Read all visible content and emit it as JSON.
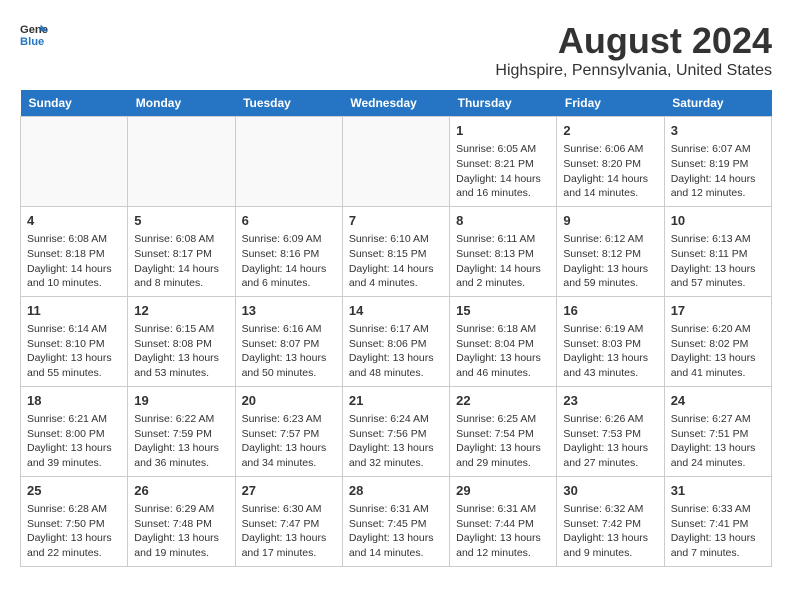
{
  "header": {
    "logo_line1": "General",
    "logo_line2": "Blue",
    "title": "August 2024",
    "subtitle": "Highspire, Pennsylvania, United States"
  },
  "days_of_week": [
    "Sunday",
    "Monday",
    "Tuesday",
    "Wednesday",
    "Thursday",
    "Friday",
    "Saturday"
  ],
  "weeks": [
    [
      {
        "day": "",
        "info": ""
      },
      {
        "day": "",
        "info": ""
      },
      {
        "day": "",
        "info": ""
      },
      {
        "day": "",
        "info": ""
      },
      {
        "day": "1",
        "info": "Sunrise: 6:05 AM\nSunset: 8:21 PM\nDaylight: 14 hours\nand 16 minutes."
      },
      {
        "day": "2",
        "info": "Sunrise: 6:06 AM\nSunset: 8:20 PM\nDaylight: 14 hours\nand 14 minutes."
      },
      {
        "day": "3",
        "info": "Sunrise: 6:07 AM\nSunset: 8:19 PM\nDaylight: 14 hours\nand 12 minutes."
      }
    ],
    [
      {
        "day": "4",
        "info": "Sunrise: 6:08 AM\nSunset: 8:18 PM\nDaylight: 14 hours\nand 10 minutes."
      },
      {
        "day": "5",
        "info": "Sunrise: 6:08 AM\nSunset: 8:17 PM\nDaylight: 14 hours\nand 8 minutes."
      },
      {
        "day": "6",
        "info": "Sunrise: 6:09 AM\nSunset: 8:16 PM\nDaylight: 14 hours\nand 6 minutes."
      },
      {
        "day": "7",
        "info": "Sunrise: 6:10 AM\nSunset: 8:15 PM\nDaylight: 14 hours\nand 4 minutes."
      },
      {
        "day": "8",
        "info": "Sunrise: 6:11 AM\nSunset: 8:13 PM\nDaylight: 14 hours\nand 2 minutes."
      },
      {
        "day": "9",
        "info": "Sunrise: 6:12 AM\nSunset: 8:12 PM\nDaylight: 13 hours\nand 59 minutes."
      },
      {
        "day": "10",
        "info": "Sunrise: 6:13 AM\nSunset: 8:11 PM\nDaylight: 13 hours\nand 57 minutes."
      }
    ],
    [
      {
        "day": "11",
        "info": "Sunrise: 6:14 AM\nSunset: 8:10 PM\nDaylight: 13 hours\nand 55 minutes."
      },
      {
        "day": "12",
        "info": "Sunrise: 6:15 AM\nSunset: 8:08 PM\nDaylight: 13 hours\nand 53 minutes."
      },
      {
        "day": "13",
        "info": "Sunrise: 6:16 AM\nSunset: 8:07 PM\nDaylight: 13 hours\nand 50 minutes."
      },
      {
        "day": "14",
        "info": "Sunrise: 6:17 AM\nSunset: 8:06 PM\nDaylight: 13 hours\nand 48 minutes."
      },
      {
        "day": "15",
        "info": "Sunrise: 6:18 AM\nSunset: 8:04 PM\nDaylight: 13 hours\nand 46 minutes."
      },
      {
        "day": "16",
        "info": "Sunrise: 6:19 AM\nSunset: 8:03 PM\nDaylight: 13 hours\nand 43 minutes."
      },
      {
        "day": "17",
        "info": "Sunrise: 6:20 AM\nSunset: 8:02 PM\nDaylight: 13 hours\nand 41 minutes."
      }
    ],
    [
      {
        "day": "18",
        "info": "Sunrise: 6:21 AM\nSunset: 8:00 PM\nDaylight: 13 hours\nand 39 minutes."
      },
      {
        "day": "19",
        "info": "Sunrise: 6:22 AM\nSunset: 7:59 PM\nDaylight: 13 hours\nand 36 minutes."
      },
      {
        "day": "20",
        "info": "Sunrise: 6:23 AM\nSunset: 7:57 PM\nDaylight: 13 hours\nand 34 minutes."
      },
      {
        "day": "21",
        "info": "Sunrise: 6:24 AM\nSunset: 7:56 PM\nDaylight: 13 hours\nand 32 minutes."
      },
      {
        "day": "22",
        "info": "Sunrise: 6:25 AM\nSunset: 7:54 PM\nDaylight: 13 hours\nand 29 minutes."
      },
      {
        "day": "23",
        "info": "Sunrise: 6:26 AM\nSunset: 7:53 PM\nDaylight: 13 hours\nand 27 minutes."
      },
      {
        "day": "24",
        "info": "Sunrise: 6:27 AM\nSunset: 7:51 PM\nDaylight: 13 hours\nand 24 minutes."
      }
    ],
    [
      {
        "day": "25",
        "info": "Sunrise: 6:28 AM\nSunset: 7:50 PM\nDaylight: 13 hours\nand 22 minutes."
      },
      {
        "day": "26",
        "info": "Sunrise: 6:29 AM\nSunset: 7:48 PM\nDaylight: 13 hours\nand 19 minutes."
      },
      {
        "day": "27",
        "info": "Sunrise: 6:30 AM\nSunset: 7:47 PM\nDaylight: 13 hours\nand 17 minutes."
      },
      {
        "day": "28",
        "info": "Sunrise: 6:31 AM\nSunset: 7:45 PM\nDaylight: 13 hours\nand 14 minutes."
      },
      {
        "day": "29",
        "info": "Sunrise: 6:31 AM\nSunset: 7:44 PM\nDaylight: 13 hours\nand 12 minutes."
      },
      {
        "day": "30",
        "info": "Sunrise: 6:32 AM\nSunset: 7:42 PM\nDaylight: 13 hours\nand 9 minutes."
      },
      {
        "day": "31",
        "info": "Sunrise: 6:33 AM\nSunset: 7:41 PM\nDaylight: 13 hours\nand 7 minutes."
      }
    ]
  ]
}
